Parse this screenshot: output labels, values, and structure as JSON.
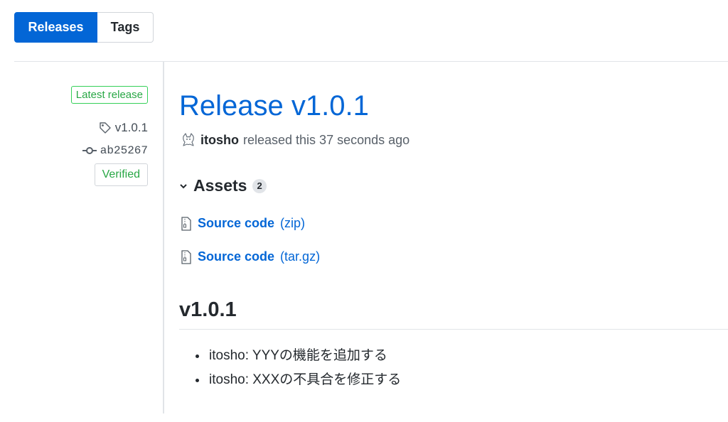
{
  "tabs": {
    "releases_label": "Releases",
    "tags_label": "Tags"
  },
  "sidebar": {
    "latest_badge": "Latest release",
    "tag_name": "v1.0.1",
    "tag_icon": "tag-icon",
    "commit_sha": "ab25267",
    "commit_icon": "git-commit-icon",
    "verified_badge": "Verified"
  },
  "release": {
    "title": "Release v1.0.1",
    "author": "itosho",
    "released_text": "released this 37 seconds ago"
  },
  "assets": {
    "title": "Assets",
    "count": "2",
    "items": [
      {
        "name": "Source code",
        "ext": "(zip)",
        "icon": "file-zip-icon"
      },
      {
        "name": "Source code",
        "ext": "(tar.gz)",
        "icon": "file-zip-icon"
      }
    ]
  },
  "notes": {
    "heading": "v1.0.1",
    "items": [
      "itosho: YYYの機能を追加する",
      "itosho: XXXの不具合を修正する"
    ]
  },
  "colors": {
    "accent": "#0366d6",
    "success": "#28a745",
    "border": "#e1e4e8"
  }
}
